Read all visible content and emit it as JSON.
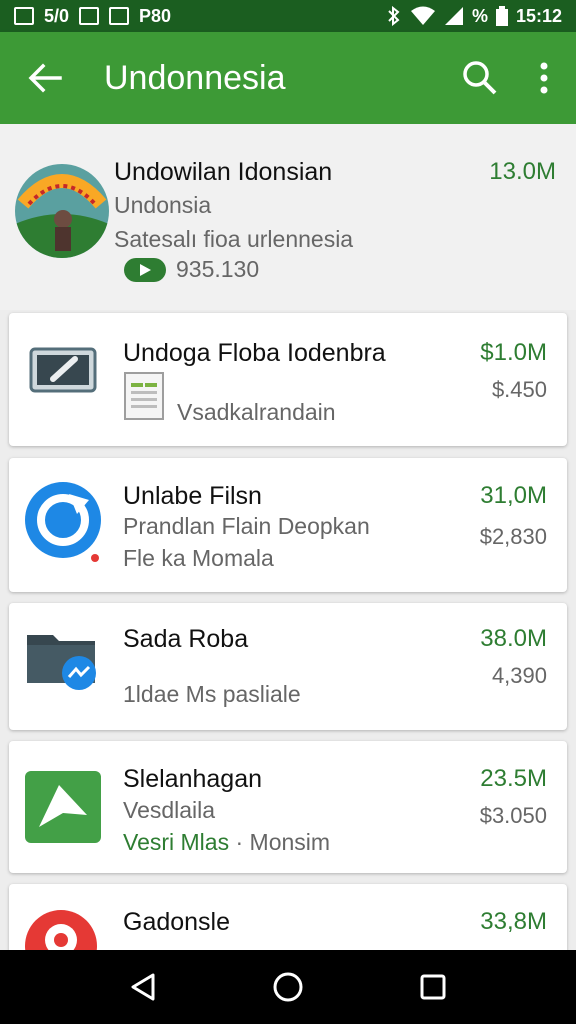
{
  "status_bar": {
    "left_text": "5/0",
    "carrier_text": "P80",
    "battery_text": "%",
    "time": "15:12"
  },
  "toolbar": {
    "title": "Undonnesia",
    "back_icon": "arrow-back-icon",
    "search_icon": "search-icon",
    "more_icon": "more-vert-icon"
  },
  "featured": {
    "title": "Undowilan Idonsian",
    "subtitle": "Undonsia",
    "description": "Satesalı fioa urlennesia",
    "play_count": "935.130",
    "size": "13.0M"
  },
  "apps": [
    {
      "title": "Undoga Floba Iodenbra",
      "line2": "",
      "line3": "Vsadkalrandain",
      "size": "$1.0M",
      "price": "$.450",
      "icon": "keyboard-icon",
      "color": "#455a64"
    },
    {
      "title": "Unlabe Filsn",
      "line2": "Prandlan Flain Deopkan",
      "line3": "Fle ka Momala",
      "size": "31,0M",
      "price": "$2,830",
      "icon": "sync-icon",
      "color": "#1e88e5"
    },
    {
      "title": "Sada Roba",
      "line2": "",
      "line3": "1ldae Ms pasliale",
      "size": "38.0M",
      "price": "4,390",
      "icon": "folder-chat-icon",
      "color": "#37474f"
    },
    {
      "title": "Slelanhagan",
      "line2": "Vesdlaila",
      "line3_green": "Vesri Mlas",
      "line3": "· Monsim",
      "size": "23.5M",
      "price": "$3.050",
      "icon": "send-icon",
      "color": "#43a047"
    },
    {
      "title": "Gadonsle",
      "line2": "",
      "line3": "",
      "size": "33,8M",
      "price": "",
      "icon": "location-pin-icon",
      "color": "#e53935"
    }
  ],
  "nav": {
    "back_icon": "nav-back-icon",
    "home_icon": "nav-home-icon",
    "recents_icon": "nav-recents-icon"
  }
}
